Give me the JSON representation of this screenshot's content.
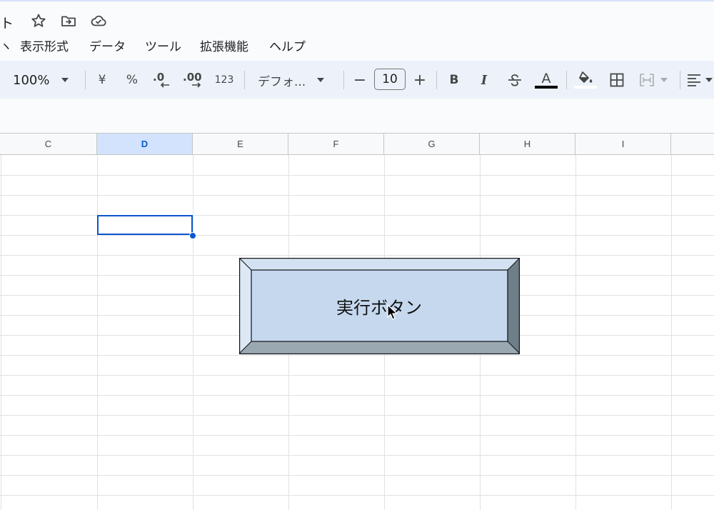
{
  "title": {
    "fragment": "ト",
    "icons": [
      "star-icon",
      "move-to-folder-icon",
      "cloud-saved-icon"
    ]
  },
  "menu": {
    "items": [
      {
        "label": "ヽ"
      },
      {
        "label": "表示形式"
      },
      {
        "label": "データ"
      },
      {
        "label": "ツール"
      },
      {
        "label": "拡張機能"
      },
      {
        "label": "ヘルプ"
      }
    ]
  },
  "toolbar": {
    "zoom": "100%",
    "currency": "¥",
    "percent": "%",
    "decrease_decimal": ".0",
    "increase_decimal": ".00",
    "number_format": "123",
    "font": "デフォ...",
    "minus": "−",
    "font_size": "10",
    "plus": "+",
    "bold": "B",
    "italic": "I",
    "text_color_letter": "A",
    "text_color": "#000000"
  },
  "sheet": {
    "columns": [
      {
        "label": "C",
        "selected": false
      },
      {
        "label": "D",
        "selected": true
      },
      {
        "label": "E",
        "selected": false
      },
      {
        "label": "F",
        "selected": false
      },
      {
        "label": "G",
        "selected": false
      },
      {
        "label": "H",
        "selected": false
      },
      {
        "label": "I",
        "selected": false
      },
      {
        "label": "",
        "selected": false
      }
    ]
  },
  "drawing": {
    "button_label": "実行ボタン",
    "face_color": "#c5d8ee",
    "bevel_light": "#dce8f5",
    "bevel_dark": "#6f7f88",
    "bevel_bottom": "#9aa8b2"
  },
  "colors": {
    "accent": "#0b57d0",
    "toolbar_bg": "#edf2fa",
    "header_selected": "#d3e3fd"
  }
}
